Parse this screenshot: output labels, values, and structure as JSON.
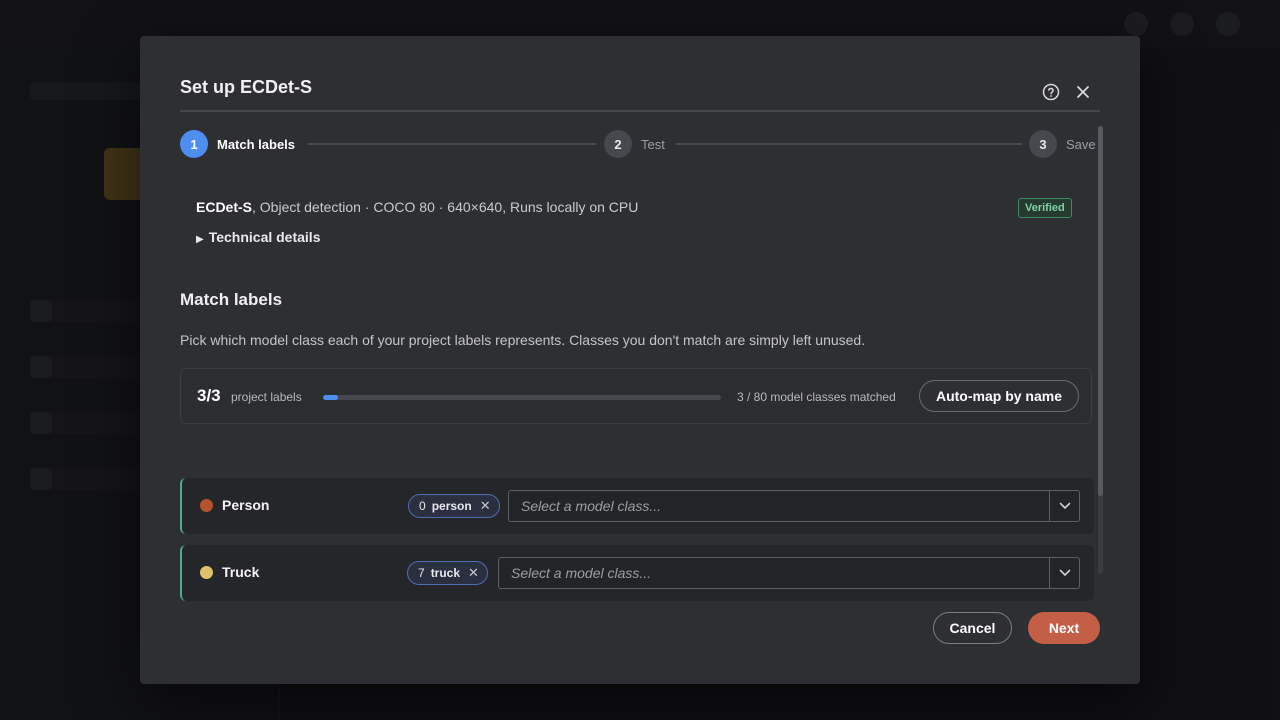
{
  "dialog": {
    "title": "Set up ECDet-S",
    "help_icon": "help-circle-icon",
    "close_icon": "close-icon"
  },
  "stepper": {
    "steps": [
      {
        "number": "1",
        "label": "Match labels",
        "active": true
      },
      {
        "number": "2",
        "label": "Test",
        "active": false
      },
      {
        "number": "3",
        "label": "Save",
        "active": false
      }
    ]
  },
  "model": {
    "name": "ECDet-S",
    "description": ", Object detection · COCO 80 · 640×640, Runs locally on CPU",
    "badge": "Verified",
    "badge_color": "#7fd3a3",
    "technical_details": "Technical details"
  },
  "match_labels": {
    "title": "Match labels",
    "description": "Pick which model class each of your project labels represents. Classes you don't match are simply left unused.",
    "progress": {
      "count": "3/3",
      "count_label": "project labels",
      "fraction": 0.0375,
      "matched": "3 / 80 model classes matched",
      "accent": "#4d8ef0"
    },
    "automap_label": "Auto-map by name",
    "rows": [
      {
        "name": "Person",
        "color": "#b5532f",
        "chip_count": "0",
        "chip_name": "person",
        "placeholder": "Select a model class..."
      },
      {
        "name": "Truck",
        "color": "#e0c06a",
        "chip_count": "7",
        "chip_name": "truck",
        "placeholder": "Select a model class..."
      }
    ]
  },
  "footer": {
    "cancel": "Cancel",
    "next": "Next",
    "next_color": "#c45f47"
  }
}
